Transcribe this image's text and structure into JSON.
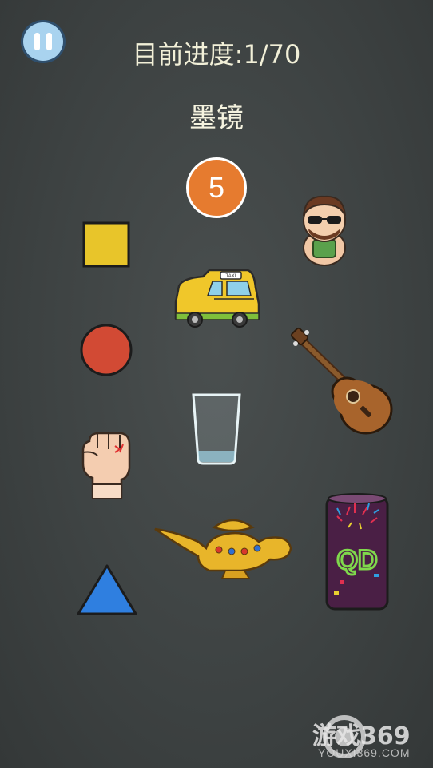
{
  "header": {
    "progress_text": "目前进度:1/70",
    "target_word": "墨镜",
    "countdown": "5"
  },
  "items": [
    {
      "name": "yellow-square",
      "icon": "square-icon",
      "color": "#e8c52a"
    },
    {
      "name": "sunglasses-man",
      "icon": "sunglasses-man-icon"
    },
    {
      "name": "taxi",
      "icon": "taxi-icon",
      "sign_text": "TAXI"
    },
    {
      "name": "red-circle",
      "icon": "circle-icon",
      "color": "#d24a34"
    },
    {
      "name": "ukulele",
      "icon": "ukulele-icon"
    },
    {
      "name": "glass",
      "icon": "glass-icon"
    },
    {
      "name": "fist",
      "icon": "fist-icon"
    },
    {
      "name": "magic-lamp",
      "icon": "lamp-icon"
    },
    {
      "name": "drink-can",
      "icon": "can-icon",
      "label": "QD"
    },
    {
      "name": "blue-triangle",
      "icon": "triangle-icon",
      "color": "#2f7fe0"
    }
  ],
  "watermark": {
    "main": "游戏369",
    "sub": "YOUXI369.COM"
  },
  "colors": {
    "board": "#3e4343",
    "pause": "#a9d3ef",
    "timer": "#e67b2f"
  }
}
